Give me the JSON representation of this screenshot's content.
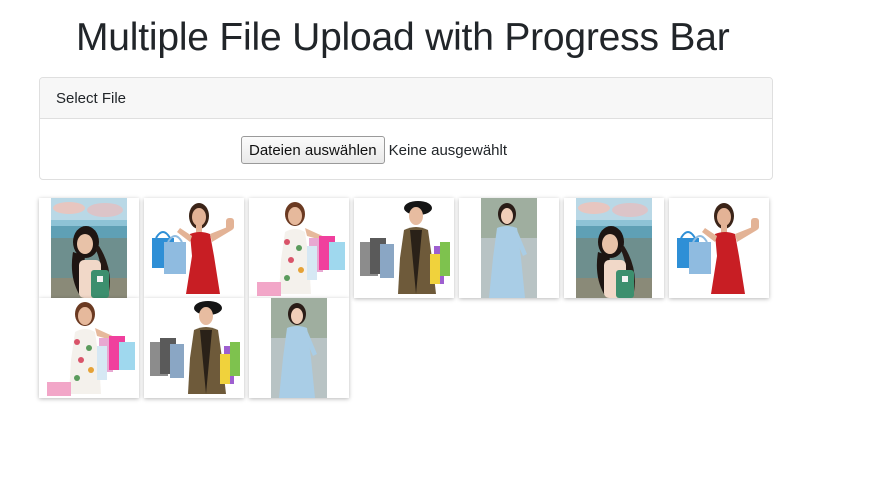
{
  "header": {
    "title": "Multiple File Upload with Progress Bar"
  },
  "upload_card": {
    "header_label": "Select File",
    "choose_button_label": "Dateien auswählen",
    "file_status": "Keine ausgewählt"
  },
  "thumbnails": [
    {
      "subject": "woman-beach-photo"
    },
    {
      "subject": "woman-red-dress-shopping-bags-photo"
    },
    {
      "subject": "woman-floral-dress-shopping-bags-photo"
    },
    {
      "subject": "woman-hat-shopping-bags-photo"
    },
    {
      "subject": "woman-blue-dress-photo"
    },
    {
      "subject": "woman-beach-photo"
    },
    {
      "subject": "woman-red-dress-shopping-bags-photo"
    },
    {
      "subject": "woman-floral-dress-shopping-bags-photo"
    },
    {
      "subject": "woman-hat-shopping-bags-photo"
    },
    {
      "subject": "woman-blue-dress-photo"
    }
  ],
  "colors": {
    "title_text": "#212529",
    "card_border": "#dfdfdf",
    "card_header_bg": "#f7f7f7"
  }
}
